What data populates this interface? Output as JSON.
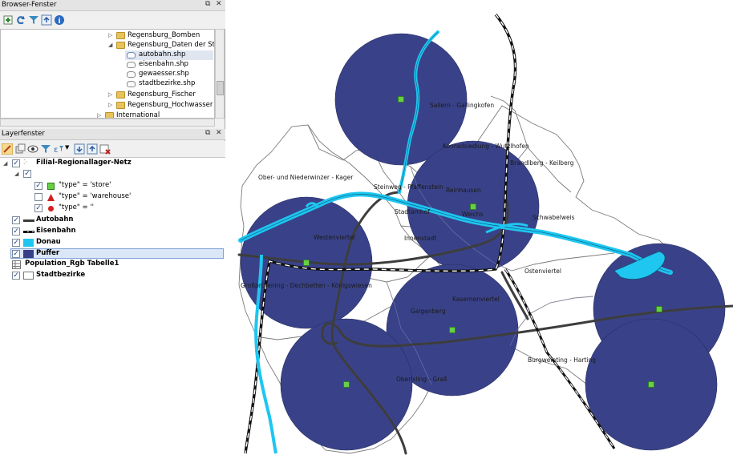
{
  "browser_panel": {
    "title": "Browser-Fenster",
    "items": [
      {
        "label": "Regensburg_Bomben",
        "type": "folder",
        "expanded": false
      },
      {
        "label": "Regensburg_Daten der Stadt",
        "type": "folder",
        "expanded": true
      },
      {
        "label": "autobahn.shp",
        "type": "shapefile",
        "selected": true
      },
      {
        "label": "eisenbahn.shp",
        "type": "shapefile"
      },
      {
        "label": "gewaesser.shp",
        "type": "shapefile"
      },
      {
        "label": "stadtbezirke.shp",
        "type": "shapefile"
      },
      {
        "label": "Regensburg_Fischer",
        "type": "folder",
        "expanded": false
      },
      {
        "label": "Regensburg_Hochwasser",
        "type": "folder",
        "expanded": false
      },
      {
        "label": "International",
        "type": "folder",
        "expanded": false
      }
    ]
  },
  "layer_panel": {
    "title": "Layerfenster",
    "layers": [
      {
        "label": "Filial-Regionallager-Netz",
        "checked": true,
        "bold": true
      },
      {
        "label": "",
        "checked": true
      },
      {
        "label": "\"type\" = 'store'",
        "checked": true,
        "symbol": "green-square"
      },
      {
        "label": "\"type\" = 'warehouse'",
        "checked": false,
        "symbol": "red-triangle"
      },
      {
        "label": "\"type\" = ''",
        "checked": true,
        "symbol": "red-dot"
      },
      {
        "label": "Autobahn",
        "checked": true,
        "bold": true,
        "symbol": "gray-line"
      },
      {
        "label": "Eisenbahn",
        "checked": true,
        "bold": true,
        "symbol": "rail-line"
      },
      {
        "label": "Donau",
        "checked": true,
        "bold": true,
        "symbol": "cyan-fill"
      },
      {
        "label": "Puffer",
        "checked": true,
        "bold": true,
        "symbol": "navy-fill",
        "selected": true
      },
      {
        "label": "Population_Rgb Tabelle1",
        "bold": true,
        "symbol": "table"
      },
      {
        "label": "Stadtbezirke",
        "checked": true,
        "bold": true,
        "symbol": "white-fill"
      }
    ]
  },
  "map": {
    "district_labels": [
      "Sallern - Gallingkofen",
      "Konradsiedlung - Wutzlhofen",
      "Brandlberg - Keilberg",
      "Ober- und Niederwinzer - Kager",
      "Steinweg - Pfaffenstein",
      "Reinhausen",
      "Stadtamhof",
      "Weichs",
      "Schwabelweis",
      "Innenstadt",
      "Westenviertel",
      "Ostenviertel",
      "Großprüfening - Dechbetten - Königswiesen",
      "Kasernenviertel",
      "Galgenberg",
      "Burgweinting - Harting",
      "Oberisling - Graß"
    ],
    "colors": {
      "buffer": "#363f87",
      "store": "#66d144",
      "river": "#1ec6f0",
      "highway": "#3d3d3d",
      "rail": "#111111",
      "district_border": "#7a7a7a"
    }
  }
}
